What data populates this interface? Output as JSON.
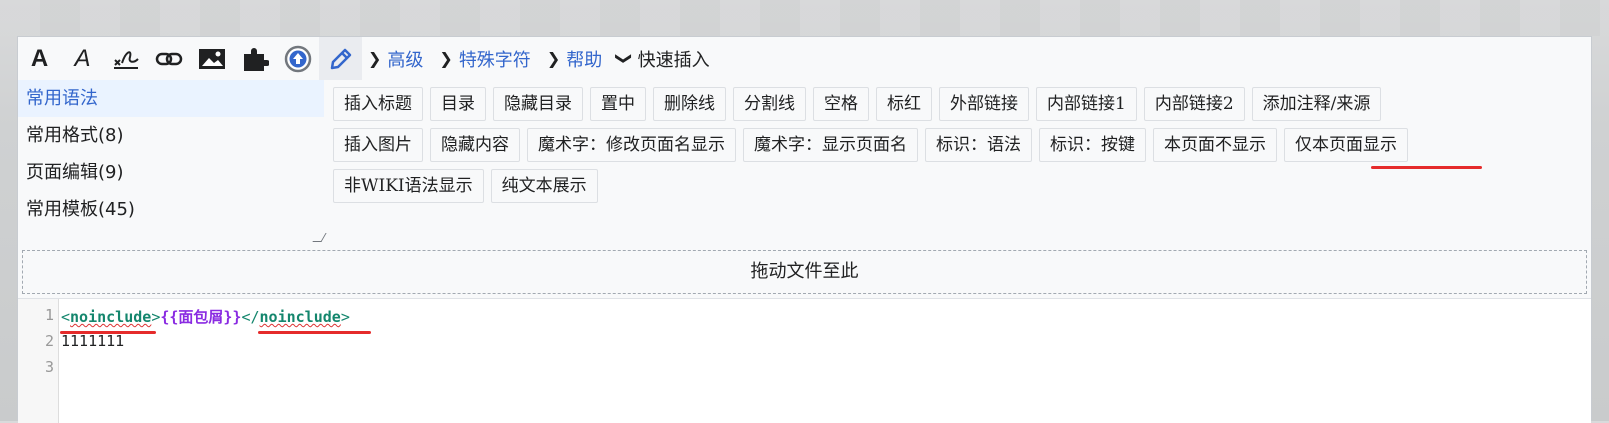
{
  "toolbar": {
    "buttons": [
      {
        "name": "bold-icon",
        "glyph": "A"
      },
      {
        "name": "italic-icon",
        "glyph": "A"
      },
      {
        "name": "signature-icon",
        "glyph": ""
      },
      {
        "name": "link-icon",
        "glyph": ""
      },
      {
        "name": "image-icon",
        "glyph": ""
      },
      {
        "name": "template-puzzle-icon",
        "glyph": ""
      },
      {
        "name": "upload-icon",
        "glyph": ""
      },
      {
        "name": "pencil-icon",
        "glyph": ""
      }
    ],
    "menus": [
      {
        "label": "高级"
      },
      {
        "label": "特殊字符"
      },
      {
        "label": "帮助"
      }
    ],
    "quick_insert": {
      "label": "快速插入"
    }
  },
  "sidebar": {
    "items": [
      {
        "label": "常用语法"
      },
      {
        "label": "常用格式(8)"
      },
      {
        "label": "页面编辑(9)"
      },
      {
        "label": "常用模板(45)"
      }
    ]
  },
  "chips": {
    "row1": [
      "插入标题",
      "目录",
      "隐藏目录",
      "置中",
      "删除线",
      "分割线",
      "空格",
      "标红",
      "外部链接",
      "内部链接1",
      "内部链接2",
      "添加注释/来源"
    ],
    "row2": [
      "插入图片",
      "隐藏内容",
      "魔术字：修改页面名显示",
      "魔术字：显示页面名",
      "标识：语法",
      "标识：按键",
      "本页面不显示",
      "仅本页面显示"
    ],
    "row3": [
      "非WIKI语法显示",
      "纯文本展示"
    ]
  },
  "dropzone": {
    "label": "拖动文件至此"
  },
  "code": {
    "line_numbers": [
      "1",
      "2",
      "3"
    ],
    "line1": {
      "open_lt": "<",
      "open_name": "noinclude",
      "open_gt": ">",
      "template": "{{面包屑}}",
      "close_lt": "</",
      "close_name": "noinclude",
      "close_gt": ">"
    },
    "line2": "1111111",
    "line3": ""
  },
  "colors": {
    "accent": "#3366cc",
    "annotation_red": "#e52b2b",
    "tag_green": "#14866d",
    "template_purple": "#8a2be2"
  }
}
